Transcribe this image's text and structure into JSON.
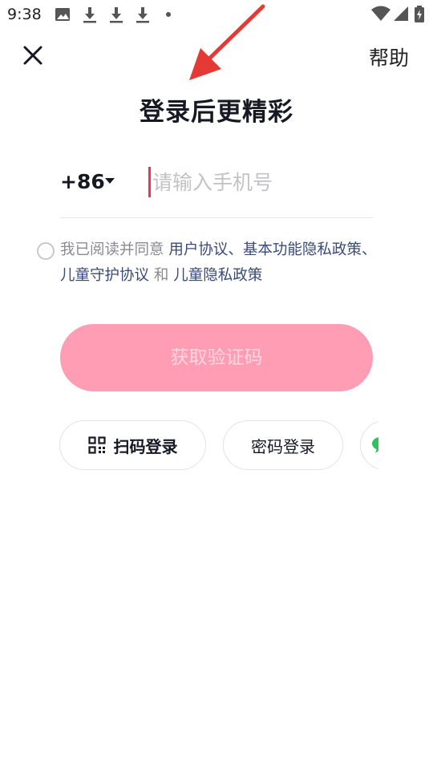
{
  "status_bar": {
    "time": "9:38",
    "icons": [
      "image-icon",
      "download-icon",
      "download-icon",
      "download-icon",
      "dot-icon",
      "wifi-icon",
      "signal-icon",
      "battery-charging-icon"
    ]
  },
  "header": {
    "close_icon": "close-icon",
    "help_label": "帮助"
  },
  "page_title": "登录后更精彩",
  "phone": {
    "country_code": "+86",
    "placeholder": "请输入手机号",
    "value": ""
  },
  "agreement": {
    "prefix": "我已阅读并同意 ",
    "user_agreement": "用户协议",
    "sep1": "、",
    "basic_privacy": "基本功能隐私政策",
    "sep2": "、",
    "child_protection": "儿童守护协议",
    "and": " 和 ",
    "child_privacy": "儿童隐私政策"
  },
  "get_code_button": "获取验证码",
  "alt_logins": {
    "qr_label": "扫码登录",
    "password_label": "密码登录"
  },
  "colors": {
    "accent": "#fe2c55",
    "button_disabled_bg": "#ff9db4",
    "link": "#3a4a79",
    "annotation_arrow": "#e53935"
  }
}
